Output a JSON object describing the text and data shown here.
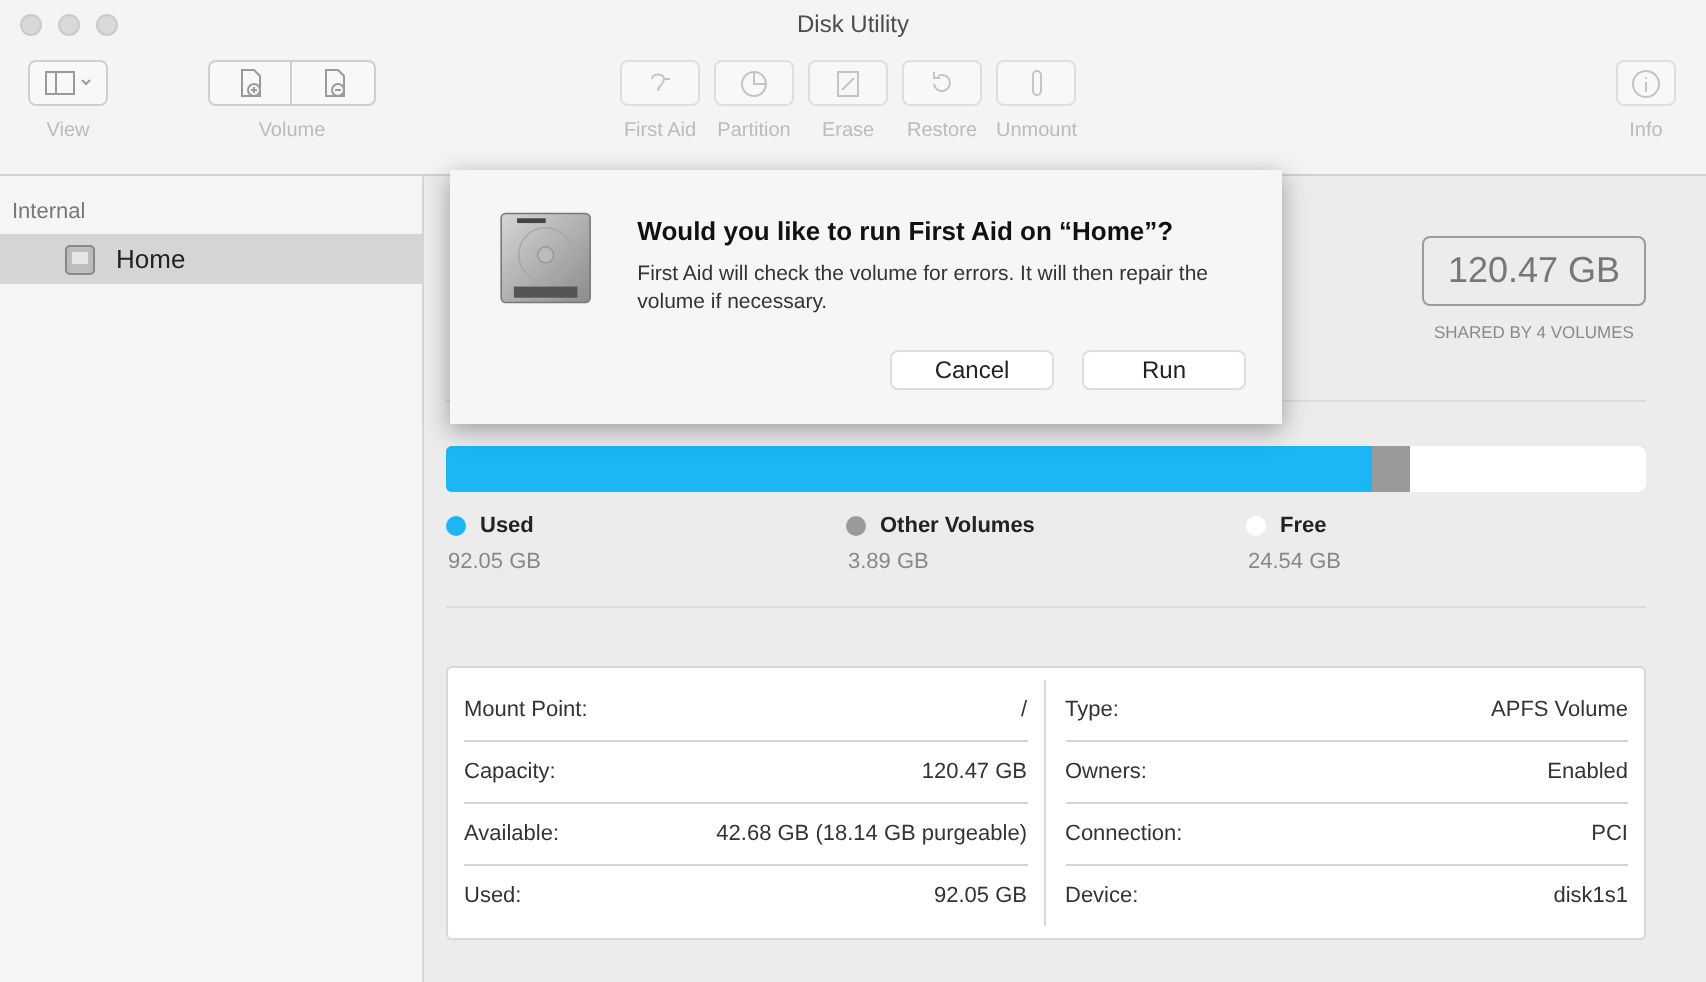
{
  "window": {
    "title": "Disk Utility"
  },
  "toolbar": {
    "groups": [
      {
        "label": "View",
        "buttons": [
          {
            "kind": "view",
            "disabled": false
          }
        ]
      },
      {
        "label": "Volume",
        "buttons": [
          {
            "kind": "add",
            "disabled": false
          },
          {
            "kind": "remove",
            "disabled": false
          }
        ]
      }
    ],
    "actions": [
      {
        "label": "First Aid",
        "kind": "firstaid",
        "disabled": true
      },
      {
        "label": "Partition",
        "kind": "partition",
        "disabled": true
      },
      {
        "label": "Erase",
        "kind": "erase",
        "disabled": true
      },
      {
        "label": "Restore",
        "kind": "restore",
        "disabled": true
      },
      {
        "label": "Unmount",
        "kind": "unmount",
        "disabled": true
      }
    ],
    "info": {
      "label": "Info",
      "disabled": true
    }
  },
  "sidebar": {
    "section": "Internal",
    "items": [
      {
        "label": "Home",
        "selected": true
      }
    ]
  },
  "capacity": {
    "value": "120.47 GB",
    "caption": "SHARED BY 4 VOLUMES"
  },
  "usage": [
    {
      "label": "Used",
      "value": "92.05 GB",
      "color": "#1ab6f5",
      "level": 0.771
    },
    {
      "label": "Other Volumes",
      "value": "3.89 GB",
      "color": "#9a9a9a"
    },
    {
      "label": "Free",
      "value": "24.54 GB",
      "color": "#ffffff",
      "level": 0.197
    }
  ],
  "details": [
    [
      {
        "label": "Mount Point:",
        "value": "/"
      },
      {
        "label": "Capacity:",
        "value": "120.47 GB"
      },
      {
        "label": "Available:",
        "value": "42.68 GB (18.14 GB purgeable)"
      },
      {
        "label": "Used:",
        "value": "92.05 GB"
      }
    ],
    [
      {
        "label": "Type:",
        "value": "APFS Volume"
      },
      {
        "label": "Owners:",
        "value": "Enabled"
      },
      {
        "label": "Connection:",
        "value": "PCI"
      },
      {
        "label": "Device:",
        "value": "disk1s1"
      }
    ]
  ],
  "dialog": {
    "title": "Would you like to run First Aid on “Home”?",
    "message": "First Aid will check the volume for errors. It will then repair the volume if necessary.",
    "buttons": [
      "Cancel",
      "Run"
    ]
  }
}
